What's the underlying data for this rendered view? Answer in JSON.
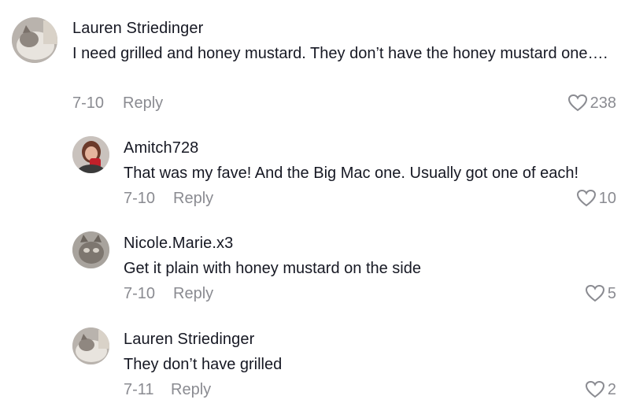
{
  "comments": [
    {
      "username": "Lauren Striedinger",
      "text": "I need grilled and honey mustard. They don’t have the honey mustard one….",
      "date": "7-10",
      "reply_label": "Reply",
      "likes": "238",
      "avatar_icon": "cat-avatar"
    },
    {
      "username": "Amitch728",
      "text": "That was my fave! And the Big Mac one. Usually got one of each!",
      "date": "7-10",
      "reply_label": "Reply",
      "likes": "10",
      "avatar_icon": "person-avatar"
    },
    {
      "username": "Nicole.Marie.x3",
      "text": "Get it plain with honey mustard on the side",
      "date": "7-10",
      "reply_label": "Reply",
      "likes": "5",
      "avatar_icon": "cat-avatar"
    },
    {
      "username": "Lauren Striedinger",
      "text": "They don’t have grilled",
      "date": "7-11",
      "reply_label": "Reply",
      "likes": "2",
      "avatar_icon": "cat-avatar"
    }
  ],
  "colors": {
    "text": "#161823",
    "secondary": "#8a8b91",
    "background": "#ffffff"
  }
}
